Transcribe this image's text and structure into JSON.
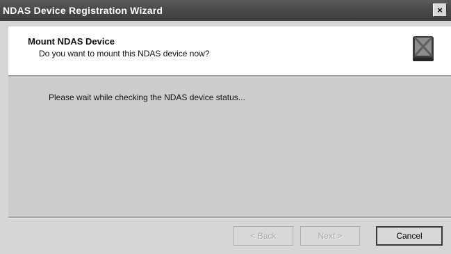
{
  "window": {
    "title": "NDAS Device Registration Wizard",
    "close_glyph": "×"
  },
  "header": {
    "title": "Mount NDAS Device",
    "subtitle": "Do you want to mount this NDAS device now?",
    "icon": "ndas-device-icon"
  },
  "body": {
    "status": "Please wait while checking the NDAS device status..."
  },
  "buttons": {
    "back": "< Back",
    "next": "Next >",
    "cancel": "Cancel"
  }
}
